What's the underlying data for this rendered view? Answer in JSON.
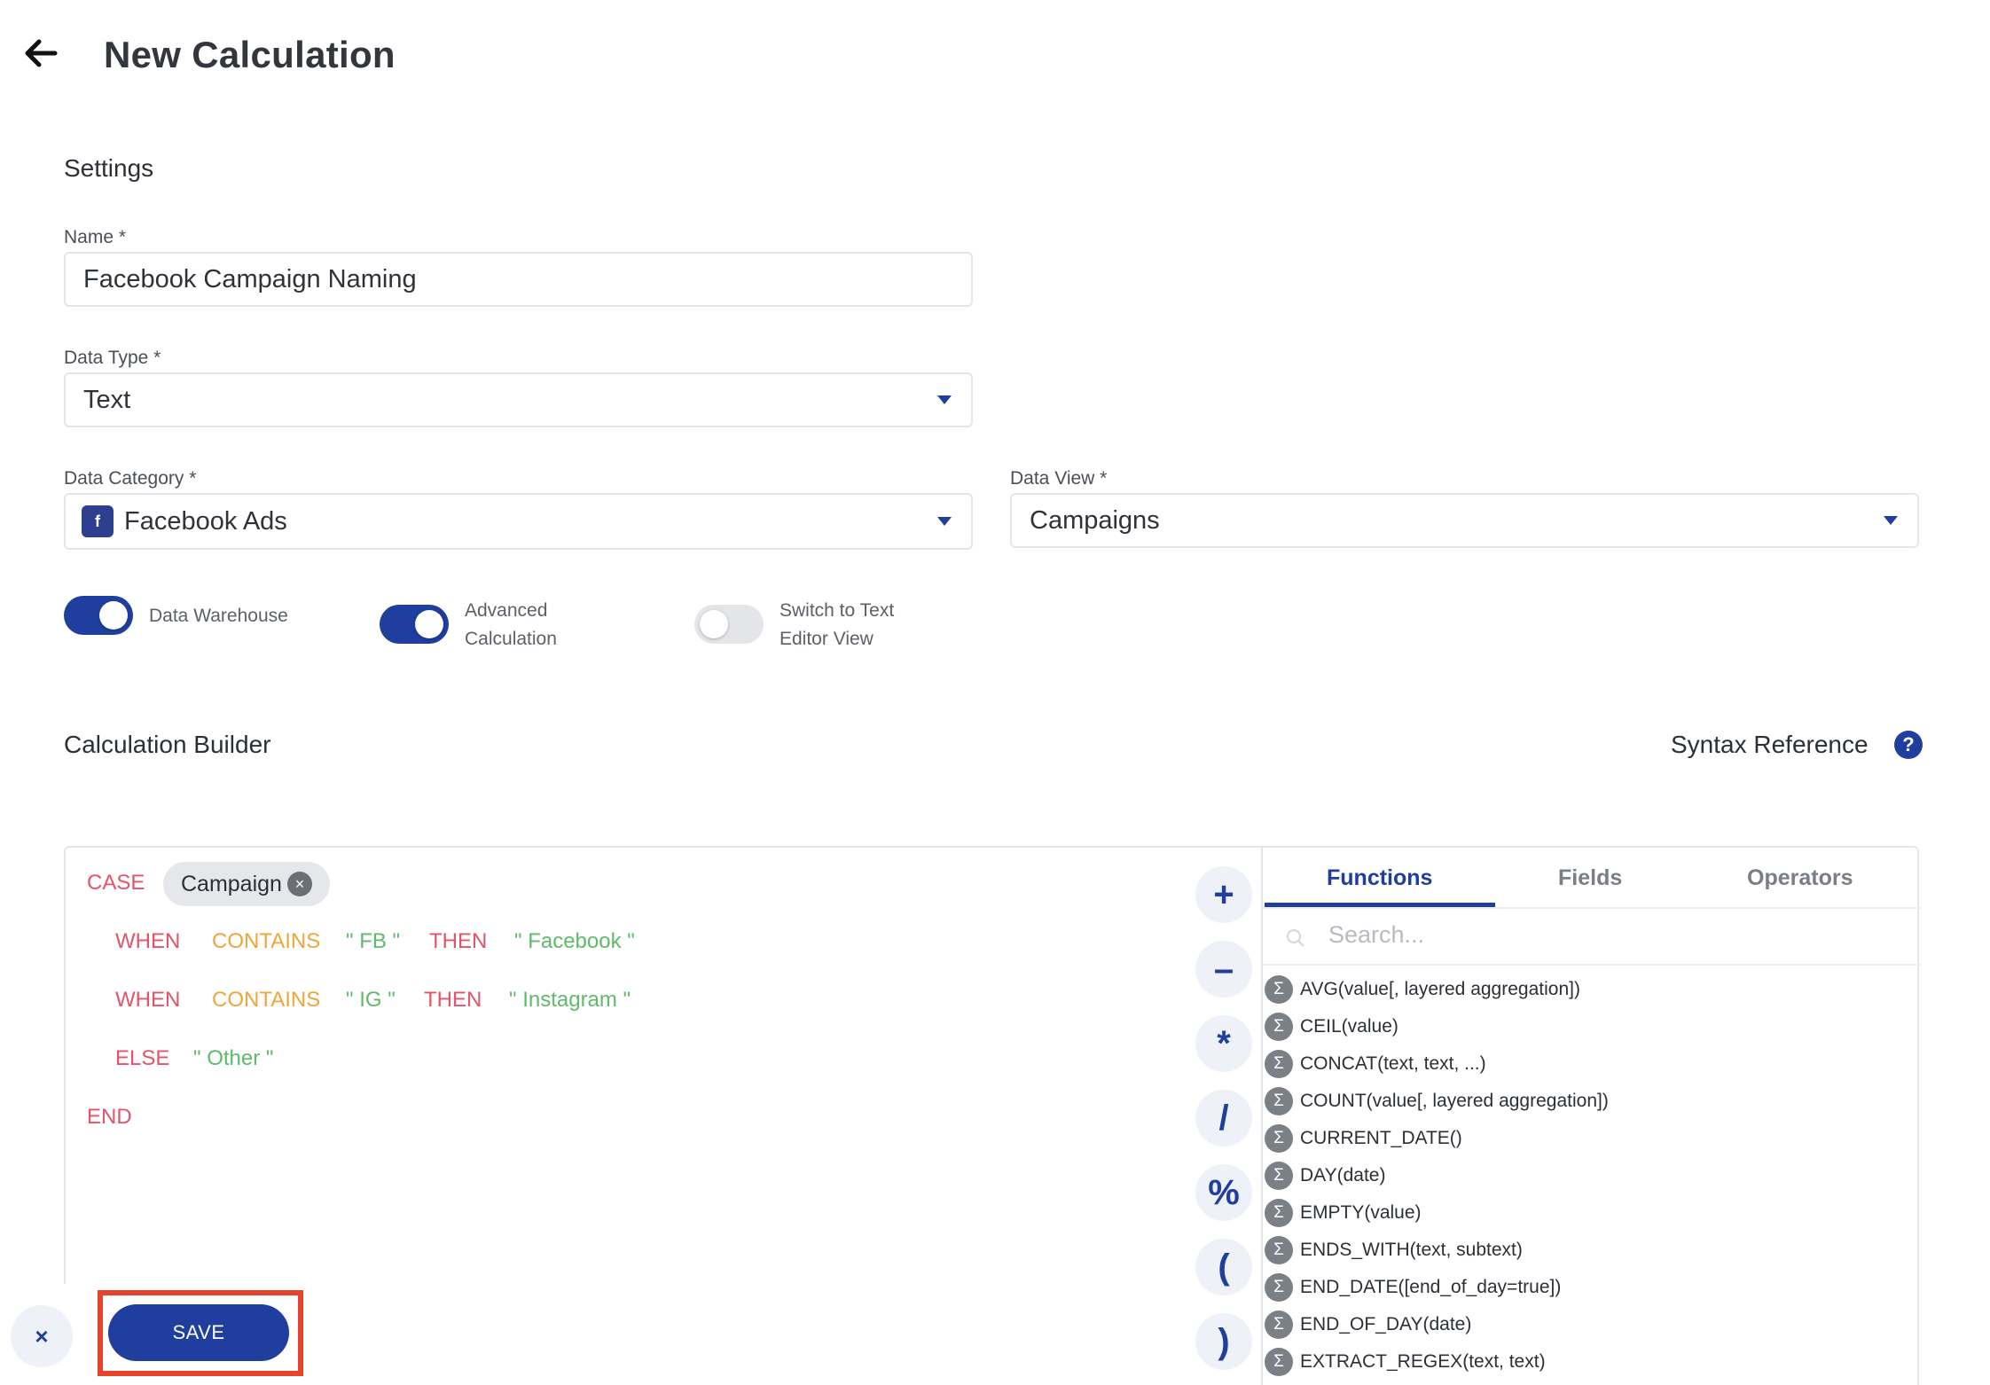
{
  "header": {
    "title": "New Calculation"
  },
  "settings": {
    "title": "Settings",
    "name": {
      "label": "Name *",
      "value": "Facebook Campaign Naming"
    },
    "data_type": {
      "label": "Data Type *",
      "value": "Text"
    },
    "data_category": {
      "label": "Data Category *",
      "value": "Facebook Ads",
      "logo_text": "f"
    },
    "data_view": {
      "label": "Data View *",
      "value": "Campaigns"
    },
    "toggles": [
      {
        "label": "Data Warehouse",
        "on": true
      },
      {
        "label_line1": "Advanced",
        "label_line2": "Calculation",
        "on": true
      },
      {
        "label_line1": "Switch to Text",
        "label_line2": "Editor View",
        "on": false
      }
    ]
  },
  "builder": {
    "title": "Calculation Builder",
    "syntax_reference": "Syntax Reference",
    "code": {
      "case": "CASE",
      "field_chip": "Campaign",
      "when1": {
        "when": "WHEN",
        "fn": "CONTAINS",
        "match": "\" FB \"",
        "then": "THEN",
        "result": "\" Facebook \""
      },
      "when2": {
        "when": "WHEN",
        "fn": "CONTAINS",
        "match": "\" IG \"",
        "then": "THEN",
        "result": "\" Instagram \""
      },
      "else": {
        "kw": "ELSE",
        "result": "\" Other \""
      },
      "end": "END"
    },
    "operators": [
      "+",
      "–",
      "*",
      "/",
      "%",
      "(",
      ")"
    ],
    "panel": {
      "tabs": [
        "Functions",
        "Fields",
        "Operators"
      ],
      "active_tab": "Functions",
      "search_placeholder": "Search...",
      "functions": [
        "AVG(value[, layered aggregation])",
        "CEIL(value)",
        "CONCAT(text, text, ...)",
        "COUNT(value[, layered aggregation])",
        "CURRENT_DATE()",
        "DAY(date)",
        "EMPTY(value)",
        "ENDS_WITH(text, subtext)",
        "END_DATE([end_of_day=true])",
        "END_OF_DAY(date)",
        "EXTRACT_REGEX(text, text)"
      ]
    }
  },
  "footer": {
    "save_label": "SAVE",
    "cancel_symbol": "×"
  },
  "colors": {
    "primary": "#1f3e9e",
    "keyword": "#e4536a",
    "function": "#f0a53a",
    "string": "#5fba6a",
    "highlight": "#e6432c"
  }
}
